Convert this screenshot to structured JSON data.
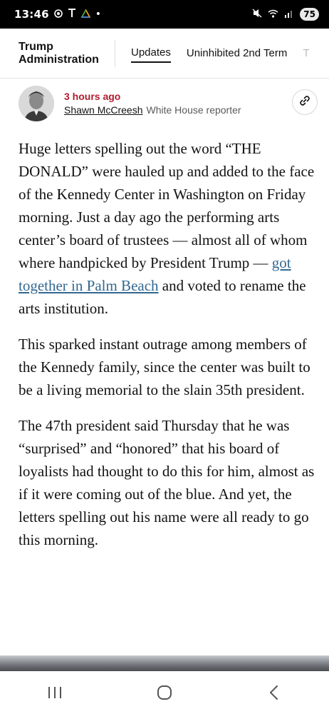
{
  "status_bar": {
    "time": "13:46",
    "battery": "75",
    "icons": [
      "target-icon",
      "antenna-icon",
      "drive-icon",
      "dot",
      "mute-icon",
      "wifi-icon",
      "signal-icon",
      "battery-icon"
    ]
  },
  "nav": {
    "section_title_line1": "Trump",
    "section_title_line2": "Administration",
    "tabs": [
      {
        "label": "Updates",
        "active": true
      },
      {
        "label": "Uninhibited 2nd Term",
        "active": false
      },
      {
        "label": "T",
        "active": false
      }
    ]
  },
  "byline": {
    "timestamp": "3 hours ago",
    "author": "Shawn McCreesh",
    "role": "White House reporter",
    "share_icon": "link-icon"
  },
  "article": {
    "p1_part1": "Huge letters spelling out the word “THE DONALD” were hauled up and added to the face of the Kennedy Center in Washington on Friday morning. Just a day ago the performing arts center’s board of trustees — almost all of whom where handpicked by President Trump — ",
    "p1_link": "got together in Palm Beach",
    "p1_part2": " and voted to rename the arts institution.",
    "p2": "This sparked instant outrage among members of the Kennedy family, since the center was built to be a living memorial to the slain 35th president.",
    "p3": "The 47th president said Thursday that he was “surprised” and “honored” that his board of loyalists had thought to do this for him, almost as if it were coming out of the blue. And yet, the letters spelling out his name were all ready to go this morning."
  },
  "colors": {
    "timestamp": "#b01c2e",
    "link": "#326891",
    "text": "#121212"
  },
  "system_nav": [
    "recents-icon",
    "home-icon",
    "back-icon"
  ]
}
